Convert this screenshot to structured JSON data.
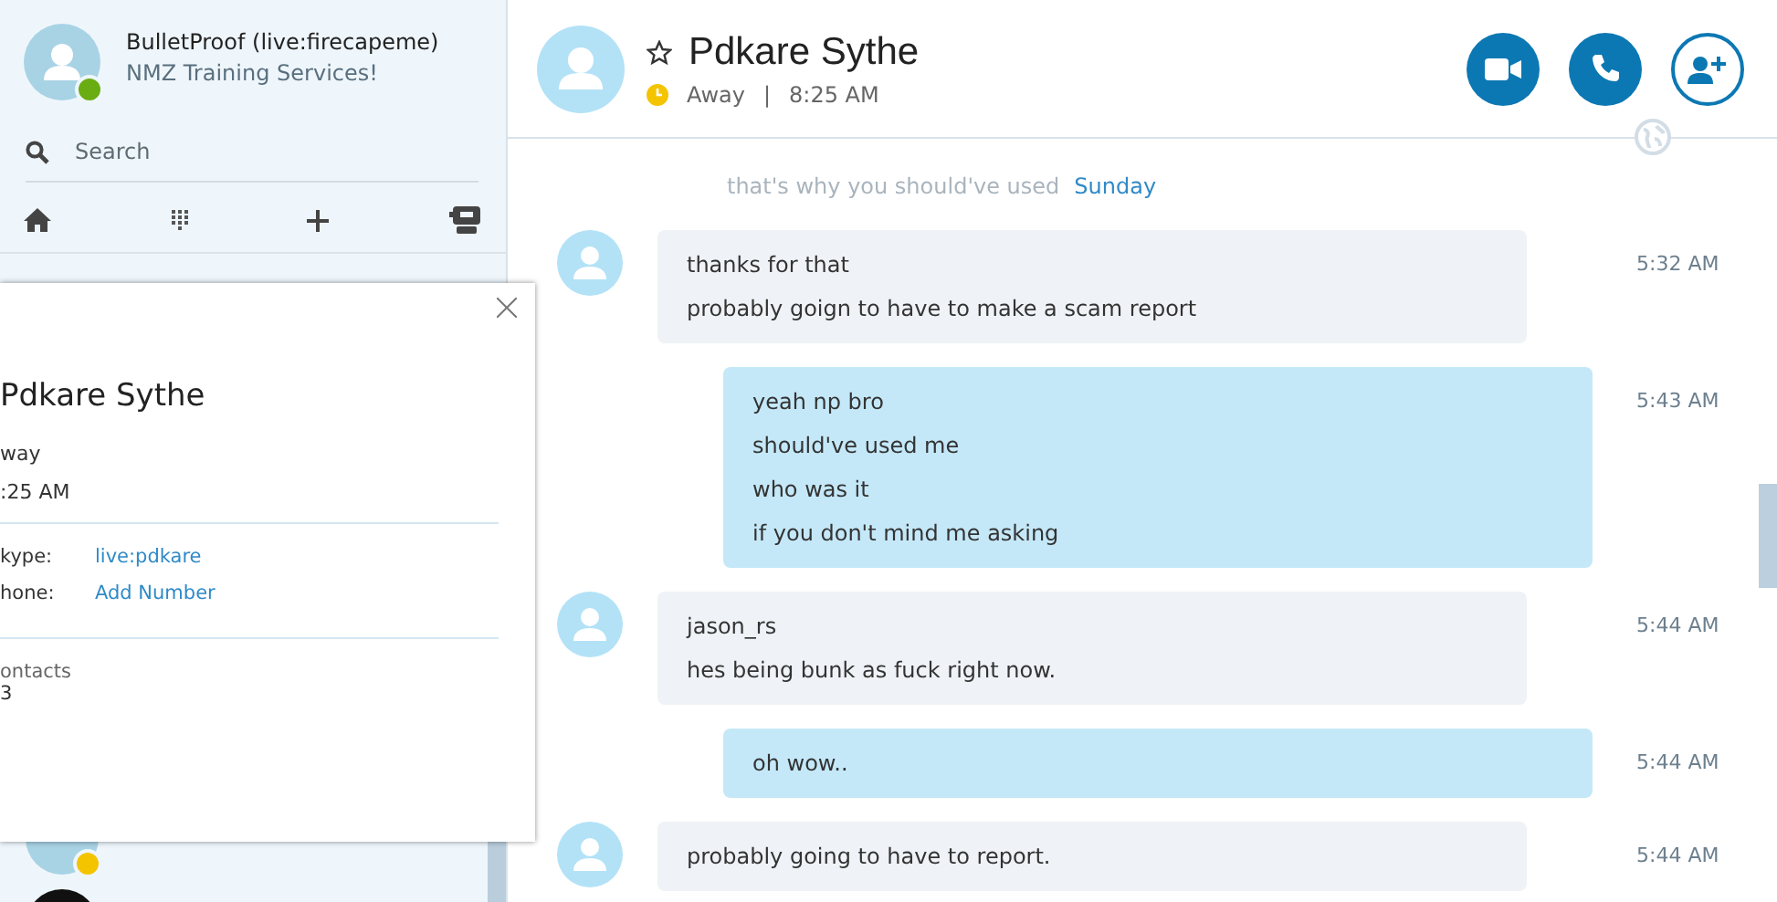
{
  "account": {
    "name": "BulletProof (live:firecapeme)",
    "mood": "NMZ Training Services!",
    "online": true
  },
  "search": {
    "placeholder": "Search"
  },
  "contacts": [
    {
      "away": true
    },
    {
      "away": false
    }
  ],
  "profile_card": {
    "name": "Pdkare Sythe",
    "status": "way",
    "time": ":25 AM",
    "fields": [
      {
        "label": "kype:",
        "value": "live:pdkare"
      },
      {
        "label": "hone:",
        "value": "Add Number"
      }
    ],
    "contacts_label": "ontacts",
    "contacts_count": "3"
  },
  "chat_header": {
    "name": "Pdkare Sythe",
    "favorite": false,
    "away": true,
    "status_text": "Away",
    "separator": "|",
    "time": "8:25 AM"
  },
  "faded_message": "that's why you should've used",
  "day_label": "Sunday",
  "messages": [
    {
      "kind": "incoming",
      "lines": [
        "thanks for that",
        "probably goign to have to make a scam report"
      ],
      "time": "5:32 AM"
    },
    {
      "kind": "outgoing",
      "lines": [
        "yeah np bro",
        "should've used me",
        "who was it",
        "if you don't mind me asking"
      ],
      "time": "5:43 AM"
    },
    {
      "kind": "incoming",
      "lines": [
        "jason_rs",
        "hes being bunk as fuck right now."
      ],
      "time": "5:44 AM"
    },
    {
      "kind": "outgoing",
      "lines": [
        "oh wow.."
      ],
      "time": "5:44 AM"
    },
    {
      "kind": "incoming",
      "lines": [
        "probably going to have to report."
      ],
      "time": "5:44 AM"
    }
  ]
}
